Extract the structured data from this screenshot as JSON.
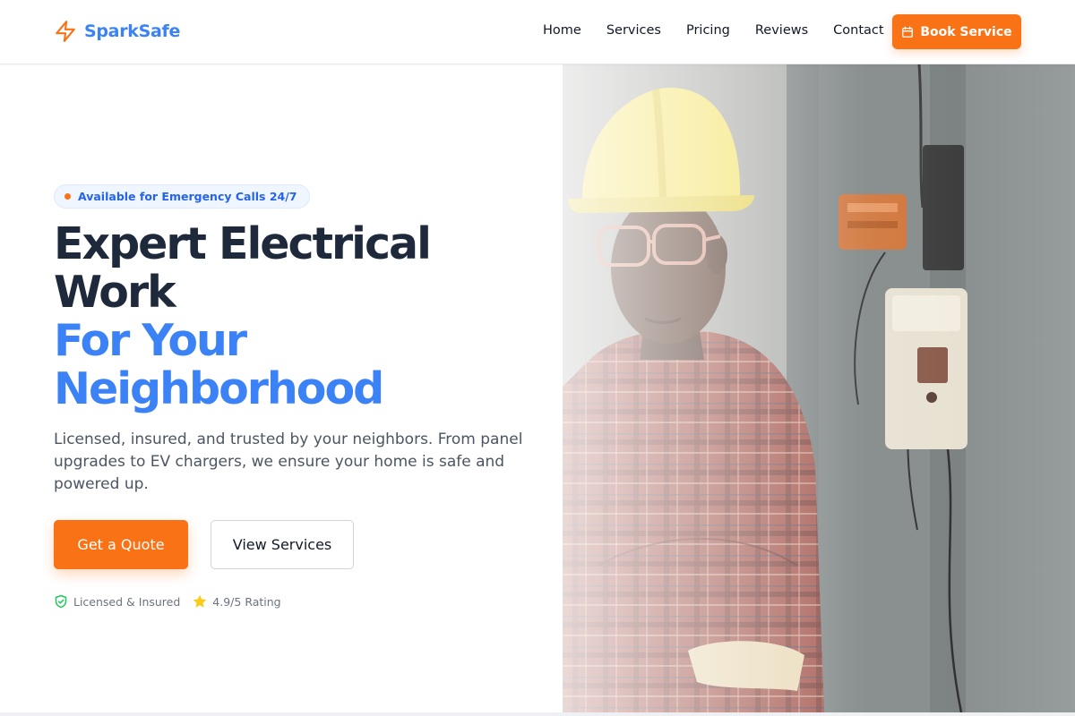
{
  "brand": {
    "name": "SparkSafe",
    "accent": "#f97316",
    "primary": "#3b82f6",
    "logo_icon": "lightning-bolt-icon"
  },
  "nav": {
    "items": [
      {
        "label": "Home"
      },
      {
        "label": "Services"
      },
      {
        "label": "Pricing"
      },
      {
        "label": "Reviews"
      },
      {
        "label": "Contact"
      }
    ],
    "cta": {
      "label": "Book Service",
      "icon": "calendar-icon"
    }
  },
  "hero": {
    "badge": "Available for Emergency Calls 24/7",
    "headline": {
      "line1": "Expert Electrical",
      "line2": "Work",
      "line3": "For Your",
      "line4": "Neighborhood"
    },
    "subtext": "Licensed, insured, and trusted by your neighbors. From panel upgrades to EV chargers, we ensure your home is safe and powered up.",
    "primary_button": "Get a Quote",
    "secondary_button": "View Services",
    "trust": [
      {
        "icon": "shield-check-icon",
        "label": "Licensed & Insured",
        "color": "#22c55e"
      },
      {
        "icon": "star-icon",
        "label": "4.9/5 Rating",
        "color": "#facc15"
      }
    ]
  },
  "colors": {
    "headline_dark": "#1e293b",
    "badge_bg": "#eff6ff",
    "badge_text": "#2563eb"
  }
}
